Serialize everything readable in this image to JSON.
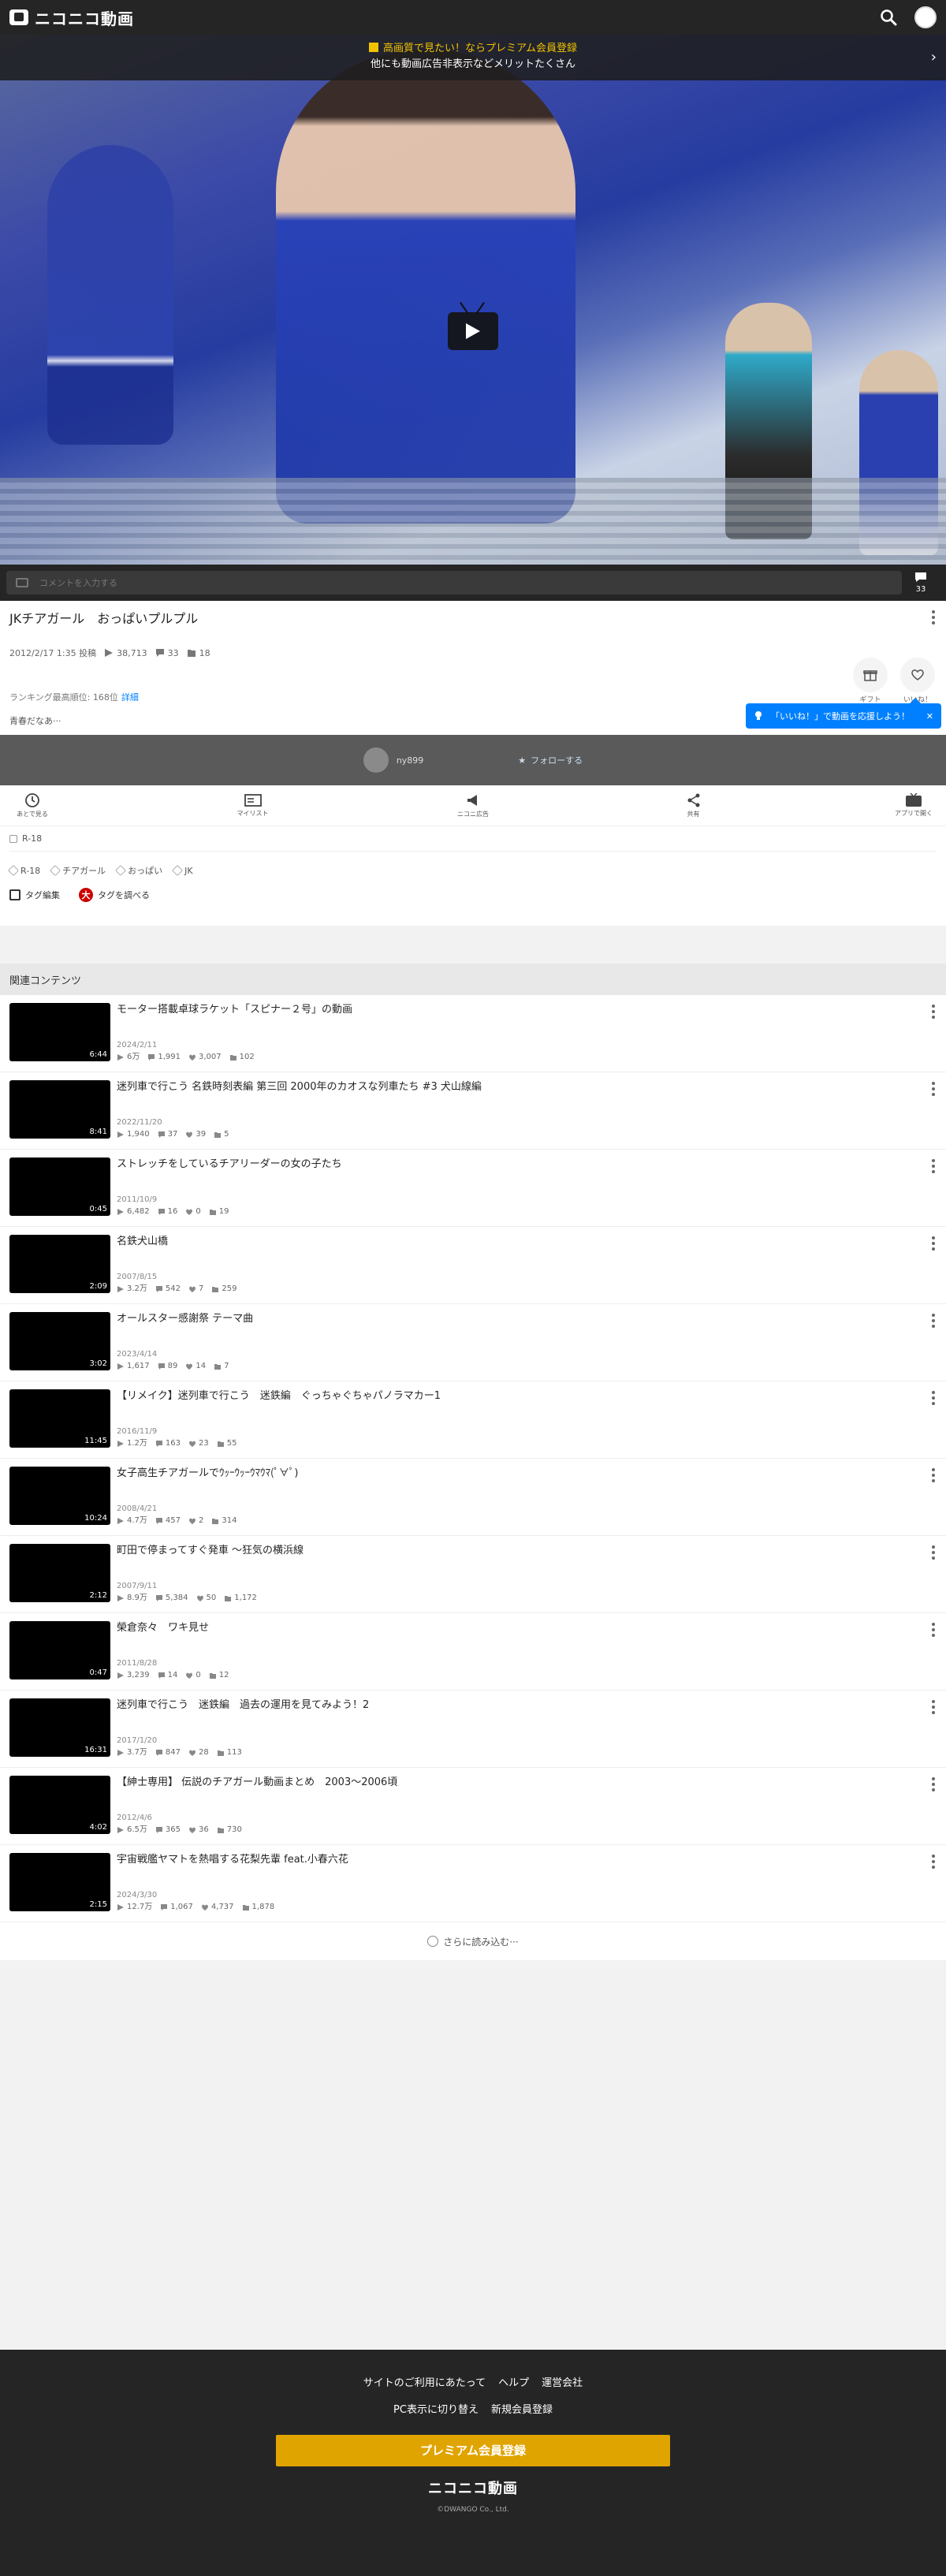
{
  "header": {
    "logo": "ニコニコ動画"
  },
  "banner": {
    "line1": "高画質で見たい！ならプレミアム会員登録",
    "line2": "他にも動画広告非表示などメリットたくさん"
  },
  "comment_bar": {
    "placeholder": "コメントを入力する",
    "count": "33"
  },
  "video": {
    "title": "JKチアガール　おっぱいプルプル",
    "posted": "2012/2/17 1:35 投稿",
    "views": "38,713",
    "comments": "33",
    "mylists": "18",
    "ranking_label": "ランキング最高順位: 168位",
    "ranking_link": "詳細",
    "description": "青春だなあ···"
  },
  "right_actions": {
    "gift": "ギフト",
    "like": "いいね！"
  },
  "like_tip": "「いいね！」で動画を応援しよう！",
  "owner": {
    "name": "ny899",
    "follow": "フォローする"
  },
  "actions": [
    {
      "label": "あとで見る"
    },
    {
      "label": "マイリスト"
    },
    {
      "label": "ニコニ広告"
    },
    {
      "label": "共有"
    },
    {
      "label": "アプリで開く"
    }
  ],
  "rating": "R-18",
  "tags": [
    "R-18",
    "チアガール",
    "おっぱい",
    "JK"
  ],
  "tag_tools": {
    "edit": "タグ編集",
    "search": "タグを調べる"
  },
  "related": {
    "heading": "関連コンテンツ",
    "items": [
      {
        "title": "モーター搭載卓球ラケット「スピナー２号」の動画",
        "duration": "6:44",
        "date": "2024/2/11",
        "views": "6万",
        "comments": "1,991",
        "likes": "3,007",
        "mylists": "102"
      },
      {
        "title": "迷列車で行こう 名鉄時刻表編 第三回 2000年のカオスな列車たち #3 犬山線編",
        "duration": "8:41",
        "date": "2022/11/20",
        "views": "1,940",
        "comments": "37",
        "likes": "39",
        "mylists": "5"
      },
      {
        "title": "ストレッチをしているチアリーダーの女の子たち",
        "duration": "0:45",
        "date": "2011/10/9",
        "views": "6,482",
        "comments": "16",
        "likes": "0",
        "mylists": "19"
      },
      {
        "title": "名鉄犬山橋",
        "duration": "2:09",
        "date": "2007/8/15",
        "views": "3.2万",
        "comments": "542",
        "likes": "7",
        "mylists": "259"
      },
      {
        "title": "オールスター感謝祭 テーマ曲",
        "duration": "3:02",
        "date": "2023/4/14",
        "views": "1,617",
        "comments": "89",
        "likes": "14",
        "mylists": "7"
      },
      {
        "title": "【リメイク】迷列車で行こう　迷鉄編　ぐっちゃぐちゃパノラマカー1",
        "duration": "11:45",
        "date": "2016/11/9",
        "views": "1.2万",
        "comments": "163",
        "likes": "23",
        "mylists": "55"
      },
      {
        "title": "女子高生チアガールでｳｯｰｳｯｰｳﾏｳﾏ(ﾟ∀ﾟ)",
        "duration": "10:24",
        "date": "2008/4/21",
        "views": "4.7万",
        "comments": "457",
        "likes": "2",
        "mylists": "314"
      },
      {
        "title": "町田で停まってすぐ発車 〜狂気の横浜線",
        "duration": "2:12",
        "date": "2007/9/11",
        "views": "8.9万",
        "comments": "5,384",
        "likes": "50",
        "mylists": "1,172"
      },
      {
        "title": "榮倉奈々　ワキ見せ",
        "duration": "0:47",
        "date": "2011/8/28",
        "views": "3,239",
        "comments": "14",
        "likes": "0",
        "mylists": "12"
      },
      {
        "title": "迷列車で行こう　迷鉄編　過去の運用を見てみよう！2",
        "duration": "16:31",
        "date": "2017/1/20",
        "views": "3.7万",
        "comments": "847",
        "likes": "28",
        "mylists": "113"
      },
      {
        "title": "【紳士専用】 伝説のチアガール動画まとめ　2003〜2006頃",
        "duration": "4:02",
        "date": "2012/4/6",
        "views": "6.5万",
        "comments": "365",
        "likes": "36",
        "mylists": "730"
      },
      {
        "title": "宇宙戦艦ヤマトを熱唱する花梨先輩 feat.小春六花",
        "duration": "2:15",
        "date": "2024/3/30",
        "views": "12.7万",
        "comments": "1,067",
        "likes": "4,737",
        "mylists": "1,878"
      }
    ],
    "load_more": "さらに読み込む···"
  },
  "footer": {
    "links_row1": [
      "サイトのご利用にあたって",
      "ヘルプ",
      "運営会社"
    ],
    "links_row2": [
      "PC表示に切り替え",
      "新規会員登録"
    ],
    "premium": "プレミアム会員登録",
    "logo": "ニコニコ動画",
    "copyright": "©DWANGO Co., Ltd."
  }
}
